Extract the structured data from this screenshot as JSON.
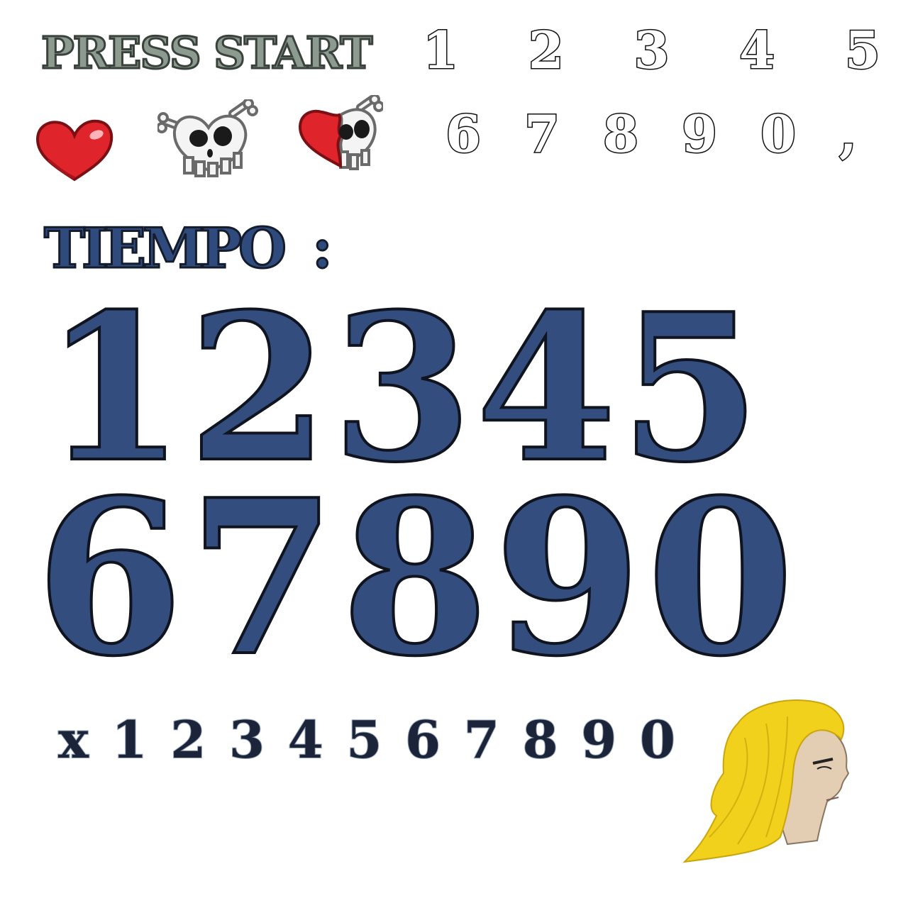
{
  "sheet": {
    "press_start": "PRESS START",
    "top_digits": [
      "1",
      "2",
      "3",
      "4",
      "5"
    ],
    "mid_digits": [
      "6",
      "7",
      "8",
      "9",
      "0",
      ","
    ],
    "tiempo_label": "TIEMPO",
    "tiempo_colon": ":",
    "big_row_1": [
      "1",
      "2",
      "3",
      "4",
      "5"
    ],
    "big_row_2": [
      "6",
      "7",
      "8",
      "9",
      "0"
    ],
    "small_row": [
      "x",
      "1",
      "2",
      "3",
      "4",
      "5",
      "6",
      "7",
      "8",
      "9",
      "0"
    ]
  },
  "icons": {
    "full_heart": "heart-icon",
    "skull_heart": "skull-heart-icon",
    "broken_skull_heart": "broken-skull-heart-icon",
    "portrait": "blonde-character-portrait"
  },
  "colors": {
    "press_start": "#8c9a90",
    "navy": "#334d7e",
    "dark_navy": "#1b2438",
    "heart_red": "#e0242c",
    "hair_yellow": "#f2d11c",
    "skin": "#e3cdb3"
  }
}
